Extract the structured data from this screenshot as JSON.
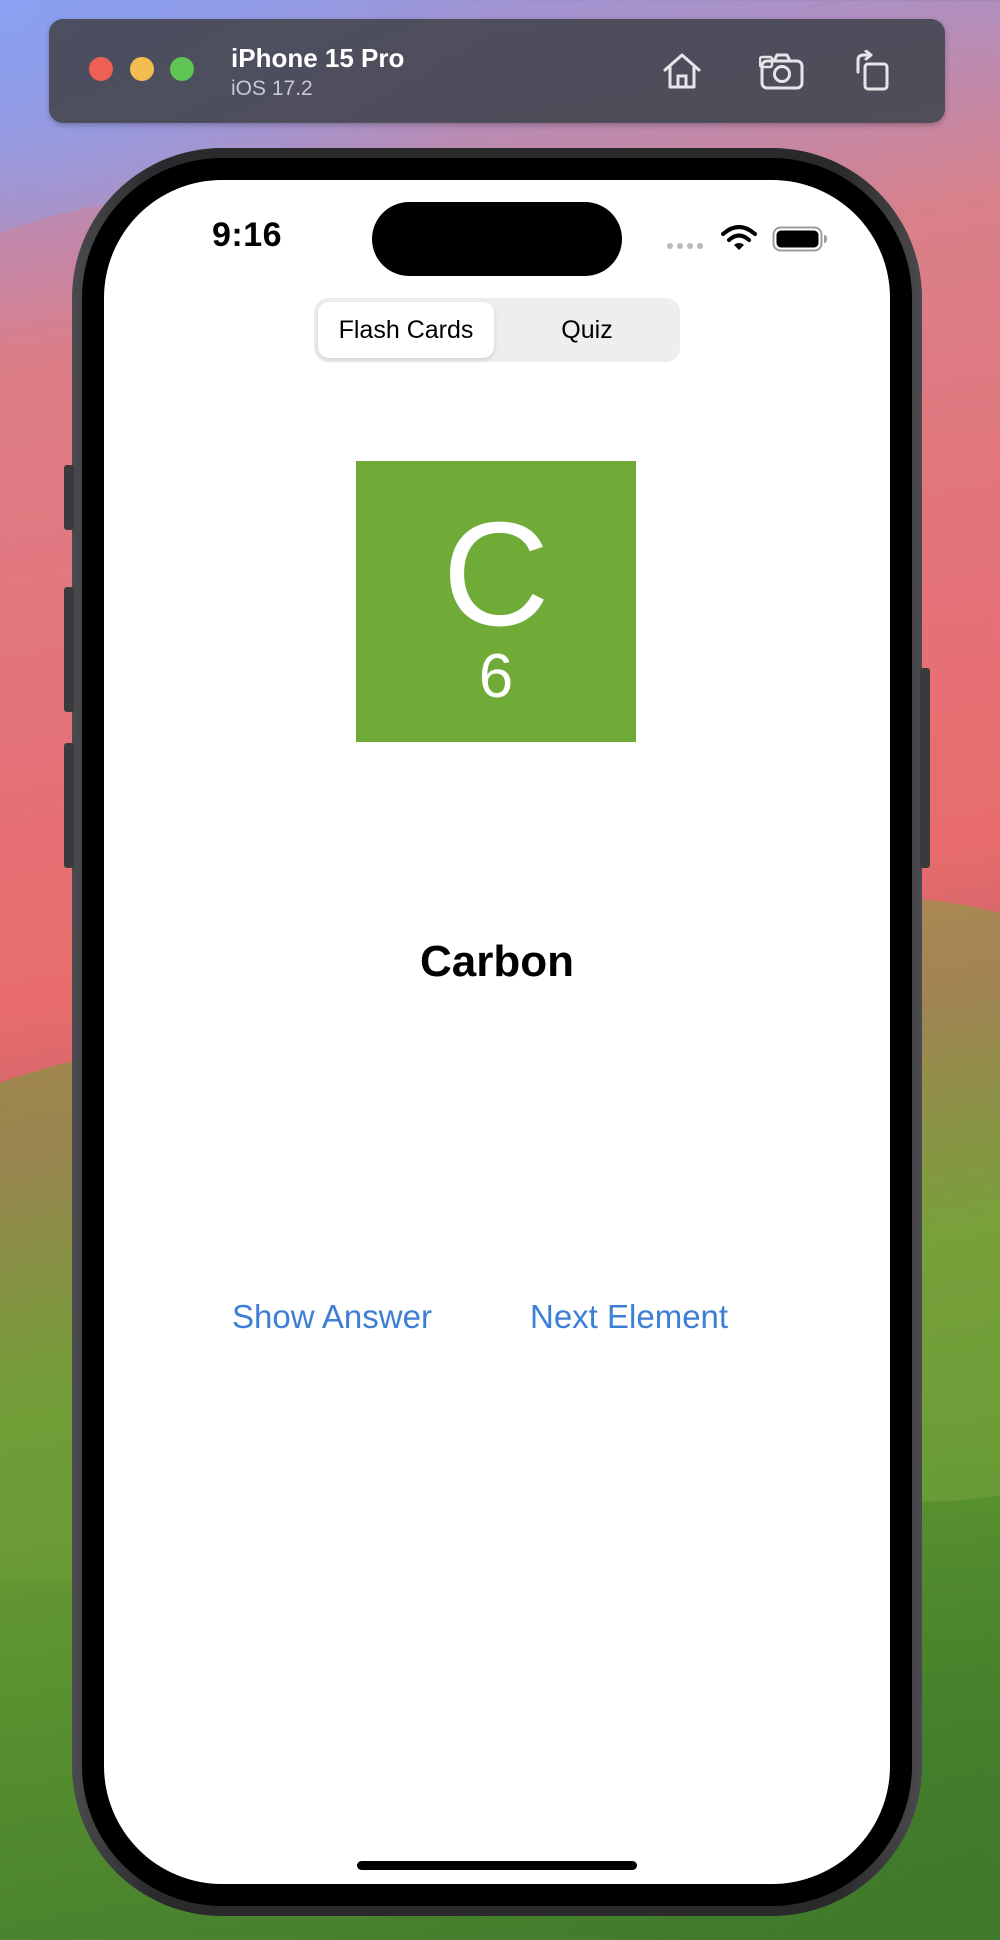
{
  "simulator": {
    "device_name": "iPhone 15 Pro",
    "os_version": "iOS 17.2",
    "buttons": {
      "home": "house-icon",
      "screenshot": "camera-icon",
      "rotate": "rotate-icon"
    }
  },
  "status_bar": {
    "time": "9:16"
  },
  "segmented_control": {
    "options": [
      "Flash Cards",
      "Quiz"
    ],
    "selected": "Flash Cards"
  },
  "card": {
    "symbol": "C",
    "atomic_number": "6",
    "tile_color": "#6fab36",
    "element_name": "Carbon"
  },
  "actions": {
    "show_answer": "Show Answer",
    "next_element": "Next Element",
    "link_color": "#3e7fd6"
  }
}
